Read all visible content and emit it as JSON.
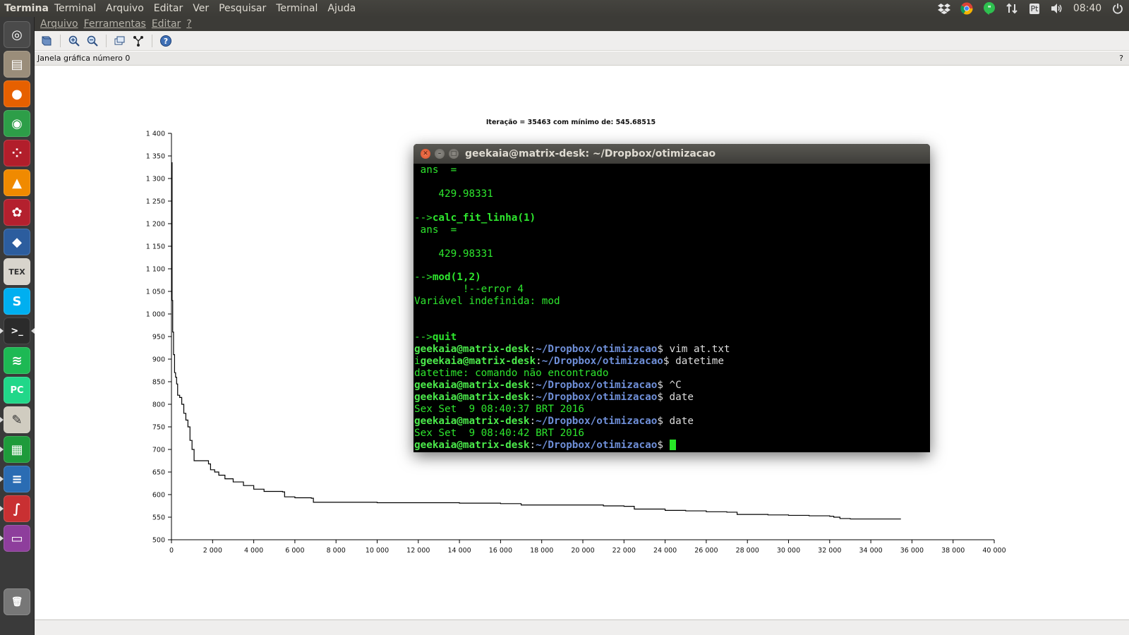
{
  "top_panel": {
    "app_name": "Terminal",
    "menus": [
      "Terminal",
      "Arquivo",
      "Editar",
      "Ver",
      "Pesquisar",
      "Terminal",
      "Ajuda"
    ],
    "keyboard_layout": "Pt",
    "clock": "08:40",
    "indicator_icons": [
      "dropbox-icon",
      "chrome-icon",
      "hangouts-icon",
      "network-icon",
      "keyboard-icon",
      "volume-icon",
      "power-icon"
    ]
  },
  "launcher": {
    "items": [
      {
        "name": "ubuntu-dash-icon",
        "color": "#4a4a4a",
        "glyph": "◎"
      },
      {
        "name": "files-icon",
        "color": "#9a8d7a",
        "glyph": "▤"
      },
      {
        "name": "firefox-icon",
        "color": "#e66000",
        "glyph": "●"
      },
      {
        "name": "chrome-icon",
        "color": "#2d9e48",
        "glyph": "◉"
      },
      {
        "name": "app-red-dots-icon",
        "color": "#b21e2b",
        "glyph": "⁘"
      },
      {
        "name": "vlc-icon",
        "color": "#f08a00",
        "glyph": "▲"
      },
      {
        "name": "mendeley-icon",
        "color": "#b4202e",
        "glyph": "✿"
      },
      {
        "name": "virtualbox-icon",
        "color": "#2c5d9e",
        "glyph": "◆"
      },
      {
        "name": "texmaker-icon",
        "color": "#d8d4cc",
        "glyph": "TEX"
      },
      {
        "name": "skype-icon",
        "color": "#00aff0",
        "glyph": "S"
      },
      {
        "name": "terminal-icon",
        "color": "#2b2b2b",
        "glyph": ">_"
      },
      {
        "name": "spotify-icon",
        "color": "#1db954",
        "glyph": "≋"
      },
      {
        "name": "pycharm-icon",
        "color": "#21d789",
        "glyph": "PC"
      },
      {
        "name": "text-editor-icon",
        "color": "#d0ccc0",
        "glyph": "✎"
      },
      {
        "name": "libreoffice-calc-icon",
        "color": "#1e9b3b",
        "glyph": "▦"
      },
      {
        "name": "libreoffice-writer-icon",
        "color": "#2a6cb3",
        "glyph": "≡"
      },
      {
        "name": "scilab-icon",
        "color": "#c93032",
        "glyph": "∫"
      },
      {
        "name": "scilab-graphic-icon",
        "color": "#8e3e9c",
        "glyph": "▭"
      },
      {
        "name": "trash-icon",
        "color": "#777777",
        "glyph": "🗑"
      }
    ]
  },
  "scilab": {
    "menus": [
      "Arquivo",
      "Ferramentas",
      "Editar",
      "?"
    ],
    "toolbar_icons": [
      "rotate-icon",
      "zoom-in-icon",
      "zoom-out-icon",
      "datatips-icon",
      "edit-axes-icon",
      "help-icon"
    ],
    "info_text": "Janela gráfica número 0",
    "help_mark": "?"
  },
  "chart_data": {
    "type": "line",
    "title": "Iteração = 35463 com mínimo de: 545.68515",
    "xlabel": "",
    "ylabel": "",
    "xlim": [
      0,
      40000
    ],
    "ylim": [
      500,
      1400
    ],
    "x_ticks": [
      0,
      2000,
      4000,
      6000,
      8000,
      10000,
      12000,
      14000,
      16000,
      18000,
      20000,
      22000,
      24000,
      26000,
      28000,
      30000,
      32000,
      34000,
      36000,
      38000,
      40000
    ],
    "x_tick_labels": [
      "0",
      "2 000",
      "4 000",
      "6 000",
      "8 000",
      "10 000",
      "12 000",
      "14 000",
      "16 000",
      "18 000",
      "20 000",
      "22 000",
      "24 000",
      "26 000",
      "28 000",
      "30 000",
      "32 000",
      "34 000",
      "36 000",
      "38 000",
      "40 000"
    ],
    "y_ticks": [
      500,
      550,
      600,
      650,
      700,
      750,
      800,
      850,
      900,
      950,
      1000,
      1050,
      1100,
      1150,
      1200,
      1250,
      1300,
      1350,
      1400
    ],
    "y_tick_labels": [
      "500",
      "550",
      "600",
      "650",
      "700",
      "750",
      "800",
      "850",
      "900",
      "950",
      "1 000",
      "1 050",
      "1 100",
      "1 150",
      "1 200",
      "1 250",
      "1 300",
      "1 350",
      "1 400"
    ],
    "grid": false,
    "series": [
      {
        "color": "#000000",
        "x": [
          0,
          30,
          60,
          100,
          150,
          200,
          250,
          300,
          400,
          500,
          600,
          700,
          800,
          900,
          1000,
          1100,
          1300,
          1800,
          1900,
          2100,
          2300,
          2600,
          3000,
          3500,
          4000,
          4500,
          5400,
          5500,
          6000,
          6800,
          6900,
          8000,
          10000,
          12000,
          14000,
          16000,
          16500,
          17000,
          20000,
          21000,
          22000,
          22500,
          23000,
          24000,
          25000,
          26000,
          27000,
          27500,
          28000,
          29000,
          30000,
          31000,
          32000,
          32200,
          32500,
          33000,
          34000,
          35463
        ],
        "y": [
          1335,
          1030,
          960,
          910,
          870,
          860,
          845,
          820,
          815,
          800,
          780,
          765,
          750,
          720,
          700,
          675,
          675,
          668,
          655,
          650,
          643,
          635,
          628,
          620,
          612,
          607,
          606,
          595,
          593,
          592,
          583,
          583,
          582,
          582,
          581,
          580,
          580,
          577,
          577,
          575,
          574,
          568,
          568,
          565,
          564,
          562,
          561,
          556,
          556,
          555,
          554,
          553,
          552,
          550,
          547,
          546,
          546,
          546
        ]
      }
    ]
  },
  "terminal": {
    "title": "geekaia@matrix-desk: ~/Dropbox/otimizacao",
    "lines": [
      {
        "type": "plain",
        "text": " ans  ="
      },
      {
        "type": "plain",
        "text": ""
      },
      {
        "type": "plain",
        "text": "    429.98331"
      },
      {
        "type": "plain",
        "text": ""
      },
      {
        "type": "scilab-cmd",
        "prefix": "-->",
        "cmd": "calc_fit_linha(1)"
      },
      {
        "type": "plain",
        "text": " ans  ="
      },
      {
        "type": "plain",
        "text": ""
      },
      {
        "type": "plain",
        "text": "    429.98331"
      },
      {
        "type": "plain",
        "text": ""
      },
      {
        "type": "scilab-cmd",
        "prefix": "-->",
        "cmd": "mod(1,2)"
      },
      {
        "type": "plain",
        "text": "        !--error 4"
      },
      {
        "type": "plain",
        "text": "Variável indefinida: mod"
      },
      {
        "type": "plain",
        "text": ""
      },
      {
        "type": "plain",
        "text": ""
      },
      {
        "type": "scilab-cmd",
        "prefix": "-->",
        "cmd": "quit"
      },
      {
        "type": "prompt",
        "lead": "",
        "user": "geekaia@matrix-desk",
        "path": "~/Dropbox/otimizacao",
        "cmd": " vim at.txt"
      },
      {
        "type": "prompt",
        "lead": "i",
        "user": "geekaia@matrix-desk",
        "path": "~/Dropbox/otimizacao",
        "cmd": " datetime"
      },
      {
        "type": "plain",
        "text": "datetime: comando não encontrado"
      },
      {
        "type": "prompt",
        "lead": "",
        "user": "geekaia@matrix-desk",
        "path": "~/Dropbox/otimizacao",
        "cmd": " ^C"
      },
      {
        "type": "prompt",
        "lead": "",
        "user": "geekaia@matrix-desk",
        "path": "~/Dropbox/otimizacao",
        "cmd": " date"
      },
      {
        "type": "plain",
        "text": "Sex Set  9 08:40:37 BRT 2016"
      },
      {
        "type": "prompt",
        "lead": "",
        "user": "geekaia@matrix-desk",
        "path": "~/Dropbox/otimizacao",
        "cmd": " date"
      },
      {
        "type": "plain",
        "text": "Sex Set  9 08:40:42 BRT 2016"
      },
      {
        "type": "prompt-cursor",
        "lead": "",
        "user": "geekaia@matrix-desk",
        "path": "~/Dropbox/otimizacao",
        "cmd": " "
      }
    ]
  }
}
